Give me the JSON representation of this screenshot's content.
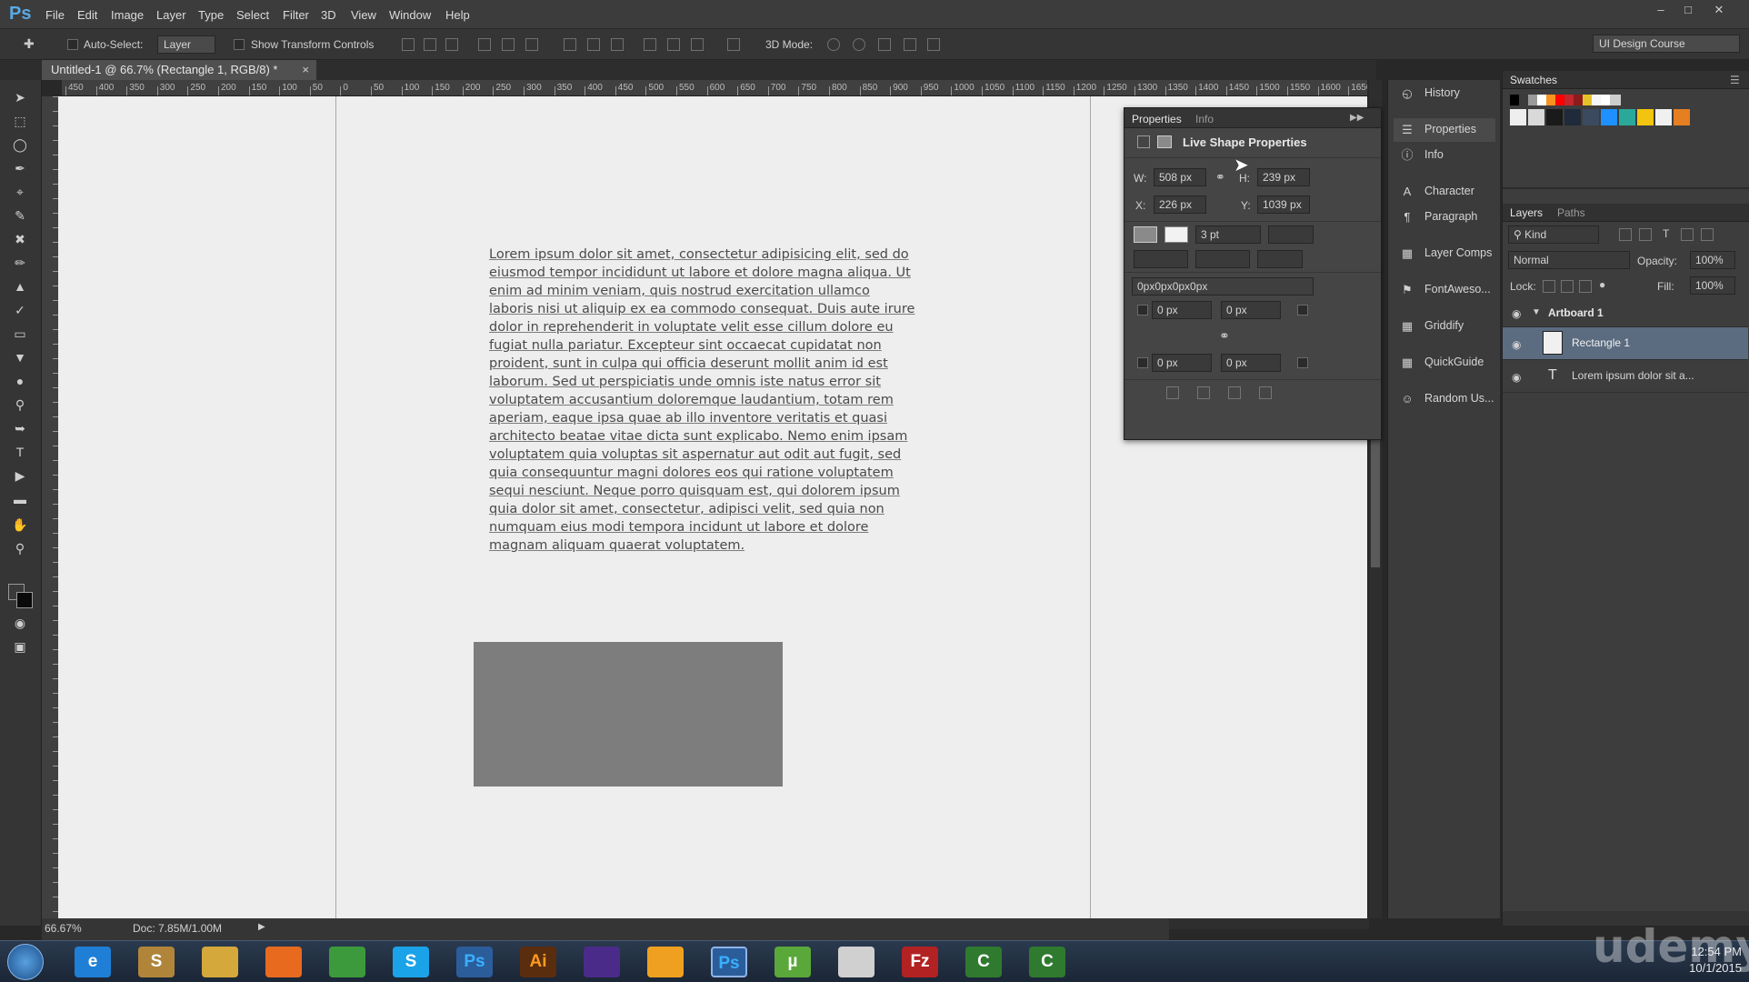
{
  "app": {
    "logo": "Ps"
  },
  "menu": [
    "File",
    "Edit",
    "Image",
    "Layer",
    "Type",
    "Select",
    "Filter",
    "3D",
    "View",
    "Window",
    "Help"
  ],
  "options": {
    "auto_select": "Auto-Select:",
    "layer_value": "Layer",
    "show_transform": "Show Transform Controls",
    "mode_3d": "3D Mode:",
    "workspace": "UI Design Course"
  },
  "document": {
    "tab": "Untitled-1 @ 66.7% (Rectangle 1, RGB/8) *",
    "close": "×"
  },
  "ruler": {
    "h": [
      "450",
      "400",
      "350",
      "300",
      "250",
      "200",
      "150",
      "100",
      "50",
      "0",
      "50",
      "100",
      "150",
      "200",
      "250",
      "300",
      "350",
      "400",
      "450",
      "500",
      "550",
      "600",
      "650",
      "700",
      "750",
      "800",
      "850",
      "900",
      "950",
      "1000",
      "1050",
      "1100",
      "1150",
      "1200",
      "1250",
      "1300",
      "1350",
      "1400",
      "1450",
      "1500",
      "1550",
      "1600",
      "1650"
    ]
  },
  "canvas": {
    "lorem": "Lorem ipsum dolor sit amet, consectetur adipisicing elit, sed do eiusmod tempor incididunt ut labore et dolore magna aliqua. Ut enim ad minim veniam, quis nostrud exercitation ullamco laboris nisi ut aliquip ex ea commodo consequat. Duis aute irure dolor in reprehenderit in voluptate velit esse cillum dolore eu fugiat nulla pariatur. Excepteur sint occaecat cupidatat non proident, sunt in culpa qui officia deserunt mollit anim id est laborum. Sed ut perspiciatis unde omnis iste natus error sit voluptatem accusantium doloremque laudantium, totam rem aperiam, eaque ipsa quae ab illo inventore veritatis et quasi architecto beatae vitae dicta sunt explicabo. Nemo enim ipsam voluptatem quia voluptas sit aspernatur aut odit aut fugit, sed quia consequuntur magni dolores eos qui ratione voluptatem sequi nesciunt. Neque porro quisquam est, qui dolorem ipsum quia dolor sit amet, consectetur, adipisci velit, sed quia non numquam eius modi tempora incidunt ut labore et dolore magnam aliquam quaerat voluptatem."
  },
  "status": {
    "zoom": "66.67%",
    "doc": "Doc: 7.85M/1.00M"
  },
  "properties": {
    "tab_properties": "Properties",
    "tab_info": "Info",
    "title": "Live Shape Properties",
    "w_label": "W:",
    "w": "508 px",
    "h_label": "H:",
    "h": "239 px",
    "x_label": "X:",
    "x": "226 px",
    "y_label": "Y:",
    "y": "1039 px",
    "stroke": "3 pt",
    "radius": "0px0px0px0px",
    "r_tl": "0 px",
    "r_tr": "0 px",
    "r_bl": "0 px",
    "r_br": "0 px"
  },
  "mid_panel": [
    "History",
    "Properties",
    "Info",
    "Character",
    "Paragraph",
    "Layer Comps",
    "FontAweso...",
    "Griddify",
    "QuickGuide",
    "Random Us..."
  ],
  "swatches": {
    "title": "Swatches",
    "colors": [
      "#000000",
      "#3b3b3b",
      "#9a9a9a",
      "#ffffff",
      "#f7941d",
      "#ff0000",
      "#c1272d",
      "#8c1b1b",
      "#e6c229",
      "#f5f5f5",
      "#ffffff",
      "#cccccc",
      "#eeeeee",
      "#d9d9d9",
      "#1a1a1a",
      "#1f2b3a",
      "#3b4a5e",
      "#1e90ff",
      "#2aa99a",
      "#f2c40f",
      "#f0f0f0",
      "#e67e22"
    ]
  },
  "layers": {
    "tab_layers": "Layers",
    "tab_paths": "Paths",
    "kind": "Kind",
    "blend": "Normal",
    "opacity_label": "Opacity:",
    "opacity": "100%",
    "lock_label": "Lock:",
    "fill_label": "Fill:",
    "fill": "100%",
    "group": "Artboard 1",
    "items": [
      "Rectangle 1",
      "Lorem ipsum dolor sit a..."
    ]
  },
  "taskbar": {
    "icons": [
      "e",
      "S",
      "",
      "",
      "",
      "S",
      "Ps",
      "Ai",
      "",
      "",
      "Ps",
      "µ",
      "",
      "Fz",
      "C",
      "C"
    ],
    "time": "12:54 PM",
    "date": "10/1/2015"
  },
  "watermark": "udemy"
}
